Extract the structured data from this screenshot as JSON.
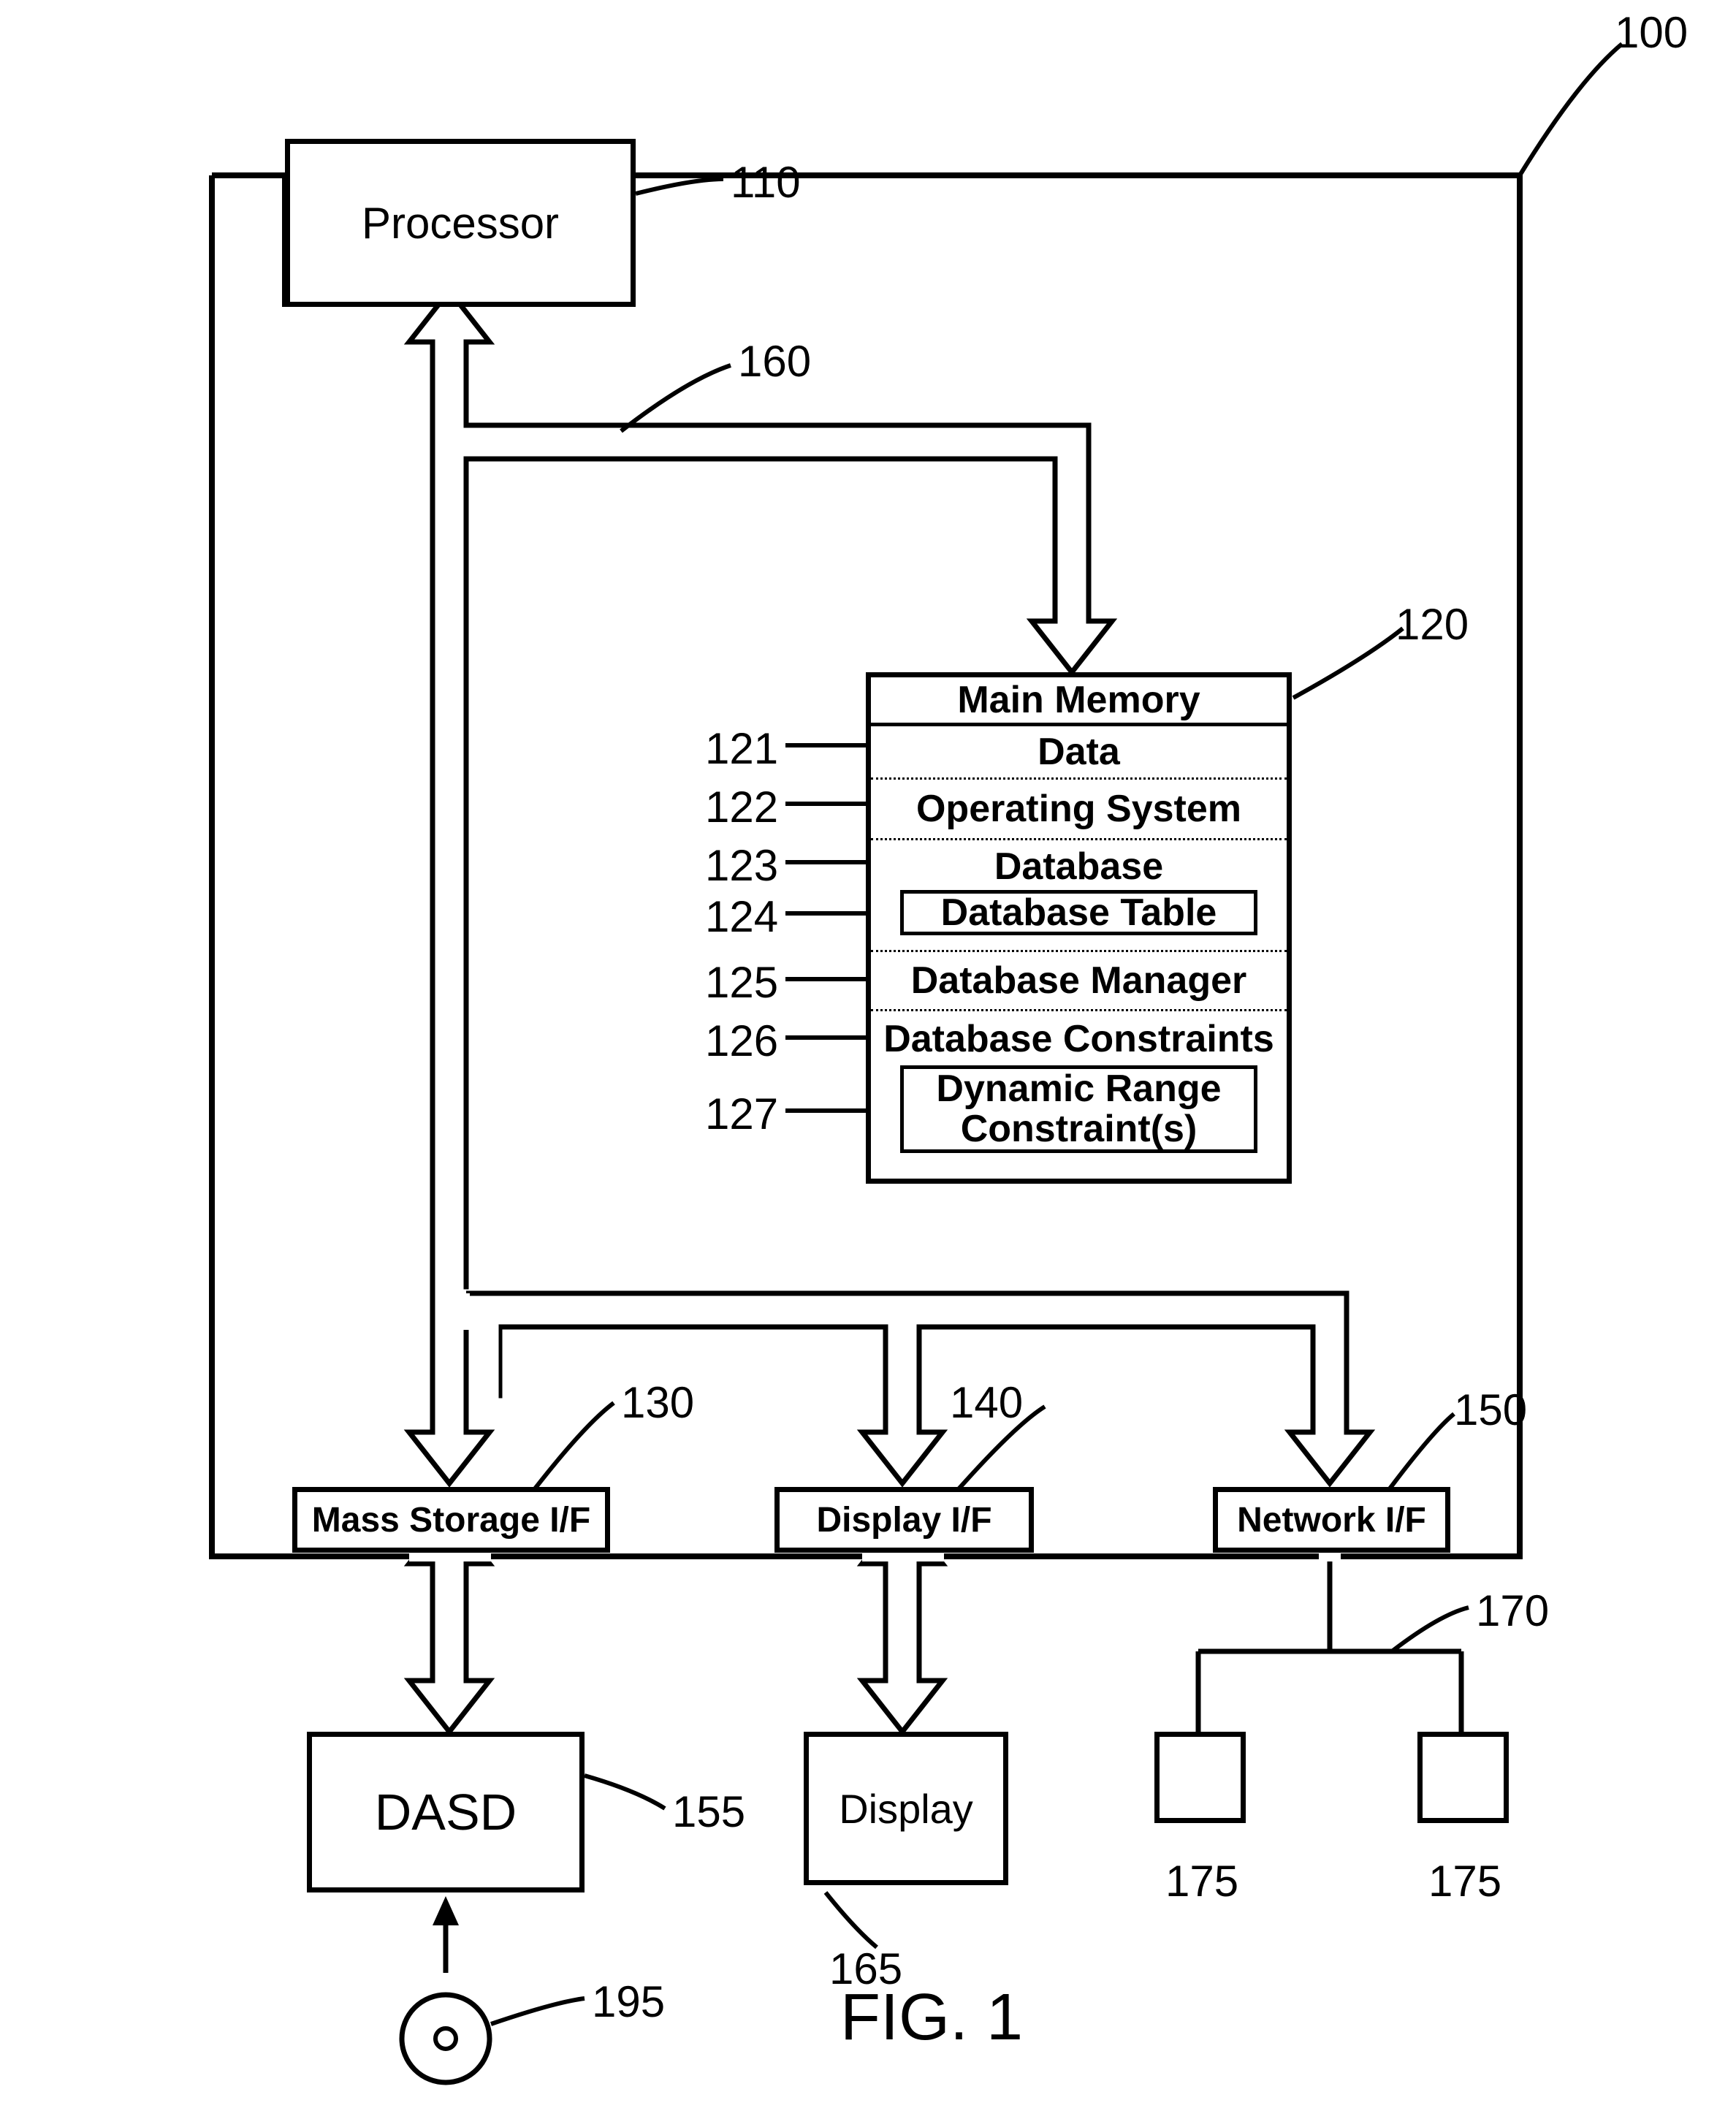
{
  "figure": {
    "caption": "FIG. 1",
    "system_ref": "100",
    "processor": {
      "label": "Processor",
      "ref": "110"
    },
    "bus": {
      "ref": "160"
    },
    "memory": {
      "title": "Main Memory",
      "ref": "120",
      "rows": {
        "r121": {
          "ref": "121",
          "label": "Data"
        },
        "r122": {
          "ref": "122",
          "label": "Operating System"
        },
        "r123": {
          "ref": "123",
          "label": "Database"
        },
        "r124": {
          "ref": "124",
          "label": "Database Table"
        },
        "r125": {
          "ref": "125",
          "label": "Database Manager"
        },
        "r126": {
          "ref": "126",
          "label": "Database Constraints"
        },
        "r127": {
          "ref": "127",
          "label": "Dynamic Range Constraint(s)"
        }
      }
    },
    "if_mass": {
      "label": "Mass Storage I/F",
      "ref": "130"
    },
    "if_display": {
      "label": "Display I/F",
      "ref": "140"
    },
    "if_network": {
      "label": "Network I/F",
      "ref": "150"
    },
    "dasd": {
      "label": "DASD",
      "ref": "155"
    },
    "display": {
      "label": "Display",
      "ref": "165"
    },
    "network_tree": {
      "ref": "170",
      "node_ref_a": "175",
      "node_ref_b": "175"
    },
    "media": {
      "ref": "195"
    }
  }
}
